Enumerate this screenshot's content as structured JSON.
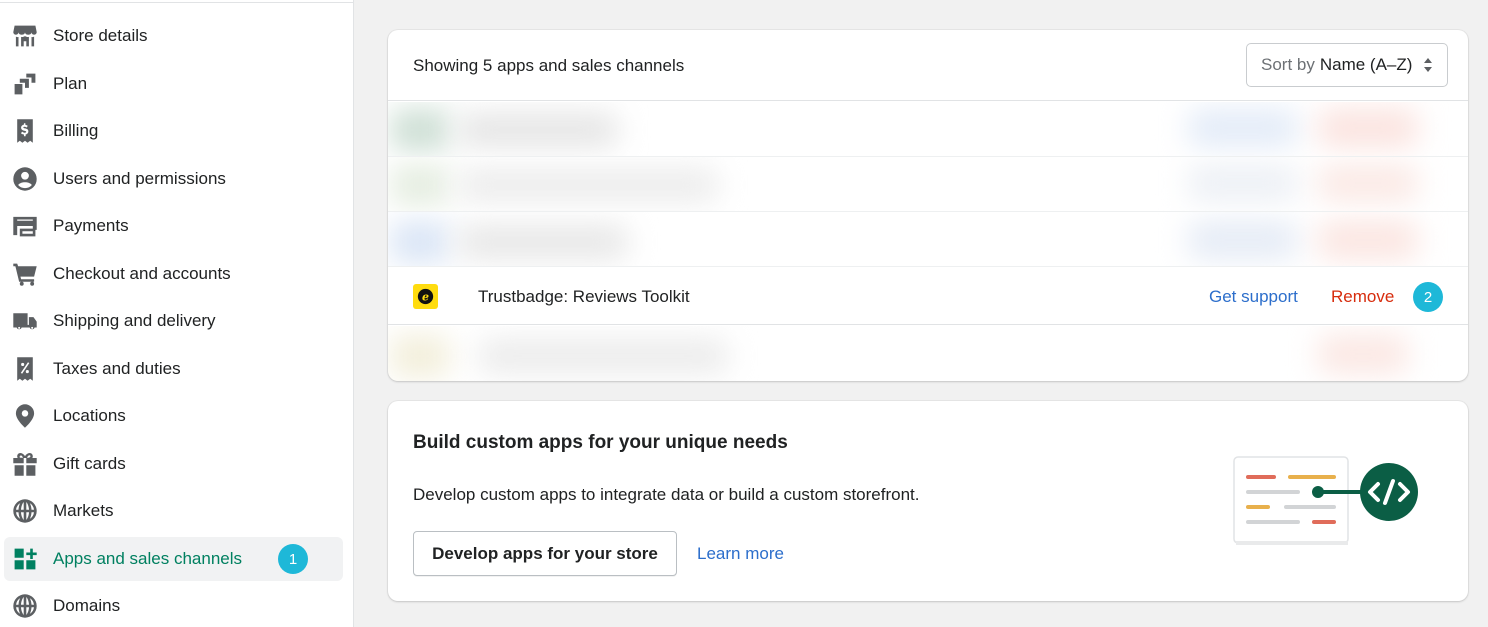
{
  "sidebar": {
    "items": [
      {
        "label": "Store details",
        "icon": "store-icon"
      },
      {
        "label": "Plan",
        "icon": "plan-icon"
      },
      {
        "label": "Billing",
        "icon": "billing-icon"
      },
      {
        "label": "Users and permissions",
        "icon": "user-icon"
      },
      {
        "label": "Payments",
        "icon": "payments-icon"
      },
      {
        "label": "Checkout and accounts",
        "icon": "cart-icon"
      },
      {
        "label": "Shipping and delivery",
        "icon": "truck-icon"
      },
      {
        "label": "Taxes and duties",
        "icon": "tax-icon"
      },
      {
        "label": "Locations",
        "icon": "location-pin-icon"
      },
      {
        "label": "Gift cards",
        "icon": "gift-icon"
      },
      {
        "label": "Markets",
        "icon": "globe-markets-icon"
      },
      {
        "label": "Apps and sales channels",
        "icon": "apps-icon",
        "active": true,
        "badge": "1"
      },
      {
        "label": "Domains",
        "icon": "globe-icon"
      }
    ]
  },
  "apps_card": {
    "count_text": "Showing 5 apps and sales channels",
    "sort": {
      "label": "Sort by",
      "value": "Name (A–Z)"
    },
    "app": {
      "name": "Trustbadge: Reviews Toolkit",
      "icon": "trustbadge-e-icon",
      "support_label": "Get support",
      "remove_label": "Remove",
      "badge": "2"
    }
  },
  "custom_apps_card": {
    "title": "Build custom apps for your unique needs",
    "description": "Develop custom apps to integrate data or build a custom storefront.",
    "primary_button": "Develop apps for your store",
    "learn_more": "Learn more",
    "illustration_icon": "code-brackets-icon"
  },
  "colors": {
    "accent": "#008060",
    "badge": "#1eb8d8",
    "link": "#2c6ecb",
    "danger": "#d72c0d"
  }
}
